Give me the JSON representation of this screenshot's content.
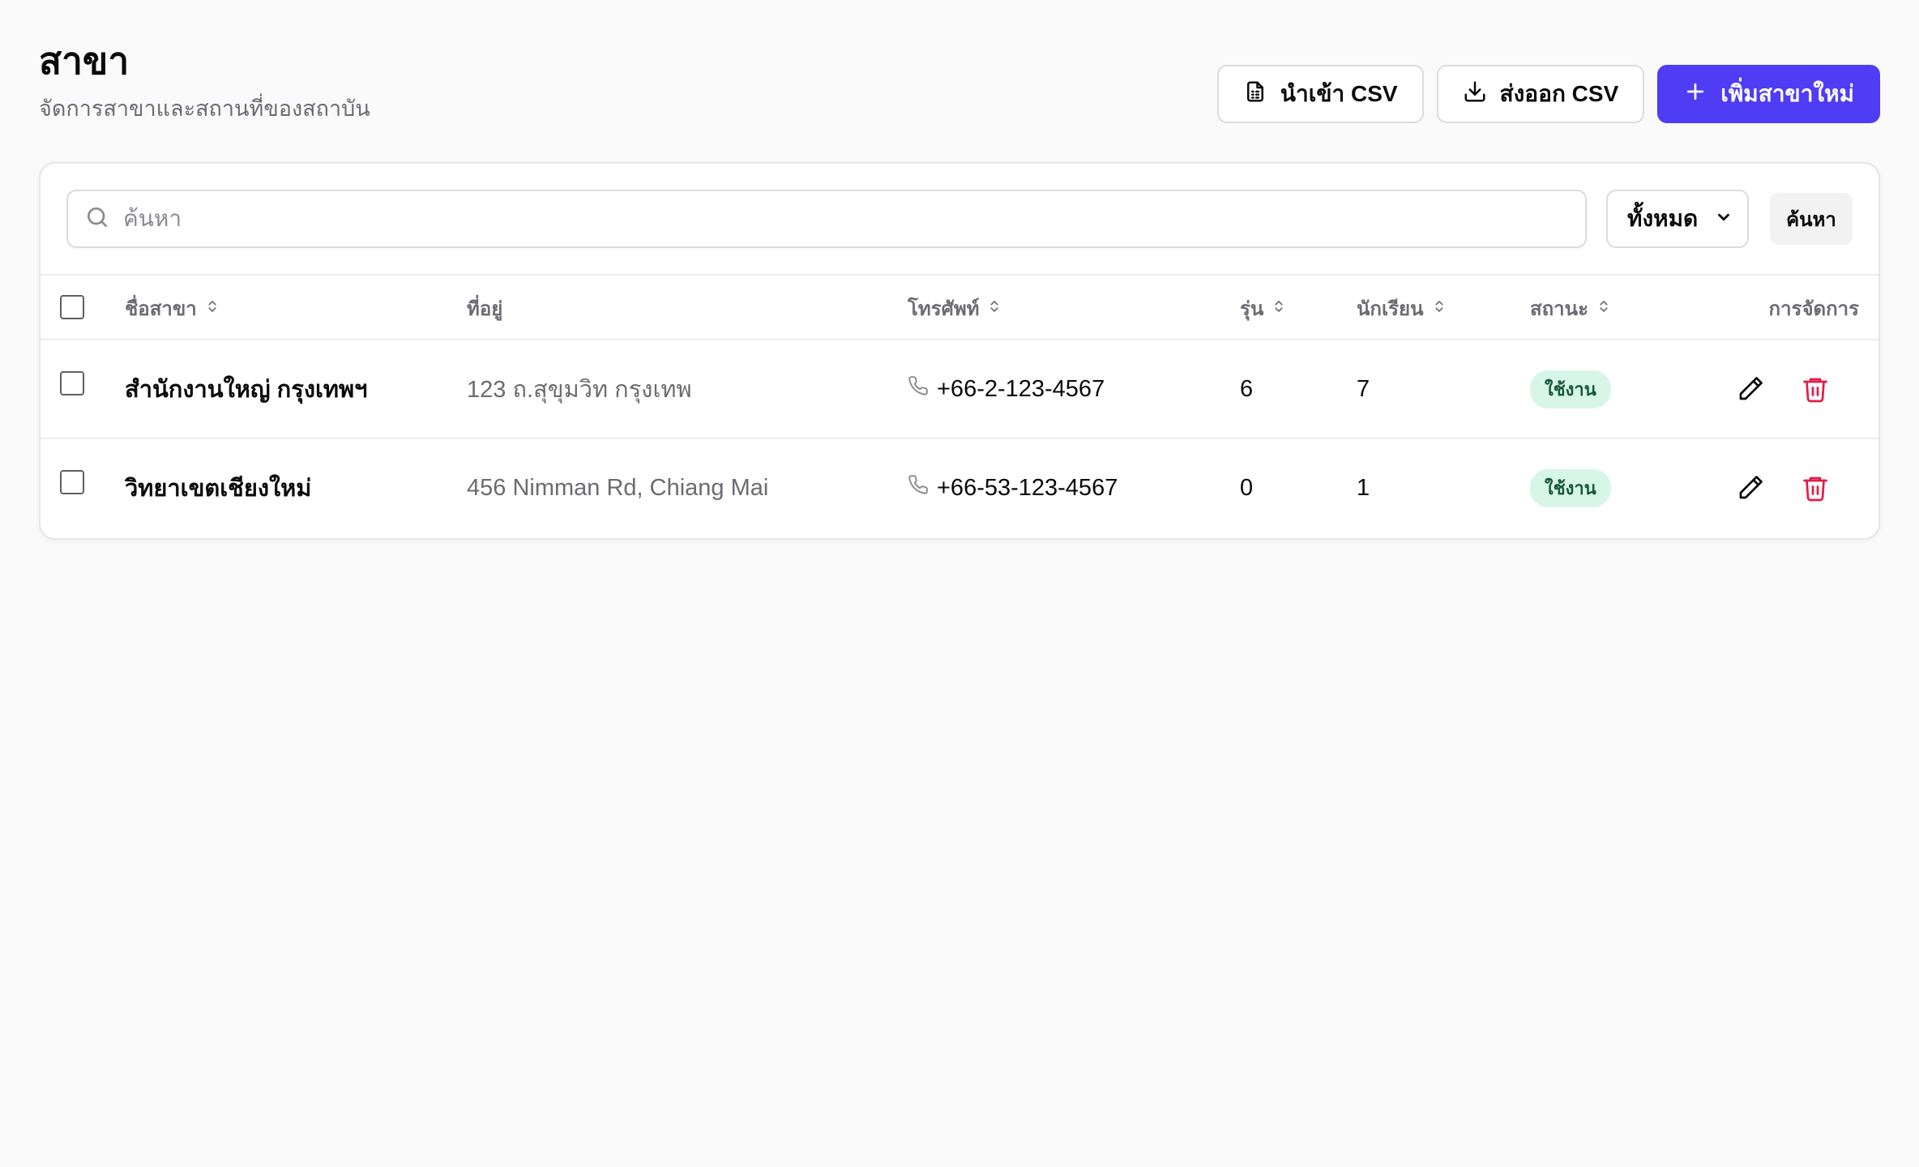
{
  "header": {
    "title": "สาขา",
    "subtitle": "จัดการสาขาและสถานที่ของสถาบัน",
    "import_label": "นำเข้า CSV",
    "export_label": "ส่งออก CSV",
    "add_label": "เพิ่มสาขาใหม่"
  },
  "toolbar": {
    "search_placeholder": "ค้นหา",
    "filter_value": "ทั้งหมด",
    "search_button": "ค้นหา"
  },
  "table": {
    "columns": [
      "ชื่อสาขา",
      "ที่อยู่",
      "โทรศัพท์",
      "รุ่น",
      "นักเรียน",
      "สถานะ",
      "การจัดการ"
    ],
    "rows": [
      {
        "name": "สำนักงานใหญ่ กรุงเทพฯ",
        "address": "123 ถ.สุขุมวิท กรุงเทพ",
        "phone": "+66-2-123-4567",
        "batches": "6",
        "students": "7",
        "status": "ใช้งาน"
      },
      {
        "name": "วิทยาเขตเชียงใหม่",
        "address": "456 Nimman Rd, Chiang Mai",
        "phone": "+66-53-123-4567",
        "batches": "0",
        "students": "1",
        "status": "ใช้งาน"
      }
    ]
  },
  "colors": {
    "primary": "#4f3cf5",
    "badge_bg": "#d8f6e7",
    "badge_text": "#15583a",
    "delete": "#e11d48"
  },
  "icons": [
    "file-csv-icon",
    "download-icon",
    "plus-icon",
    "search-icon",
    "chevron-down-icon",
    "sort-icon",
    "phone-icon",
    "pencil-icon",
    "trash-icon"
  ]
}
